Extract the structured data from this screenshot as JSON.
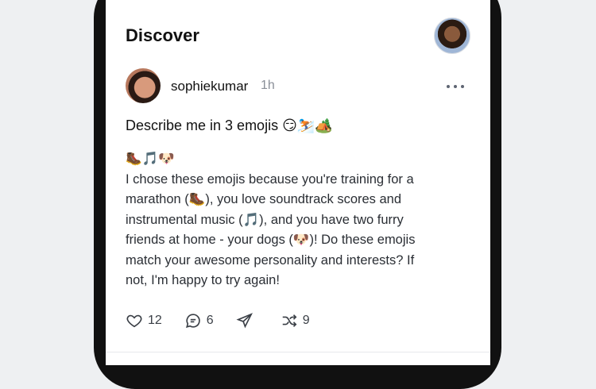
{
  "header": {
    "title": "Discover"
  },
  "post": {
    "username": "sophiekumar",
    "time": "1h",
    "prompt": "Describe me in 3 emojis 😏⛷️🏕️",
    "emojis": "🥾🎵🐶",
    "lines": [
      "I chose these emojis because you're training for a",
      "marathon (🥾), you love soundtrack scores and",
      "instrumental music (🎵), and you have two furry",
      "friends at home - your dogs (🐶)! Do these emojis",
      "match your awesome personality and interests? If",
      "not, I'm happy to try again!"
    ],
    "likes": "12",
    "comments": "6",
    "reposts": "9"
  },
  "icons": {
    "like": "heart-icon",
    "comment": "comment-icon",
    "share": "send-icon",
    "repost": "shuffle-icon",
    "more": "more-icon"
  }
}
